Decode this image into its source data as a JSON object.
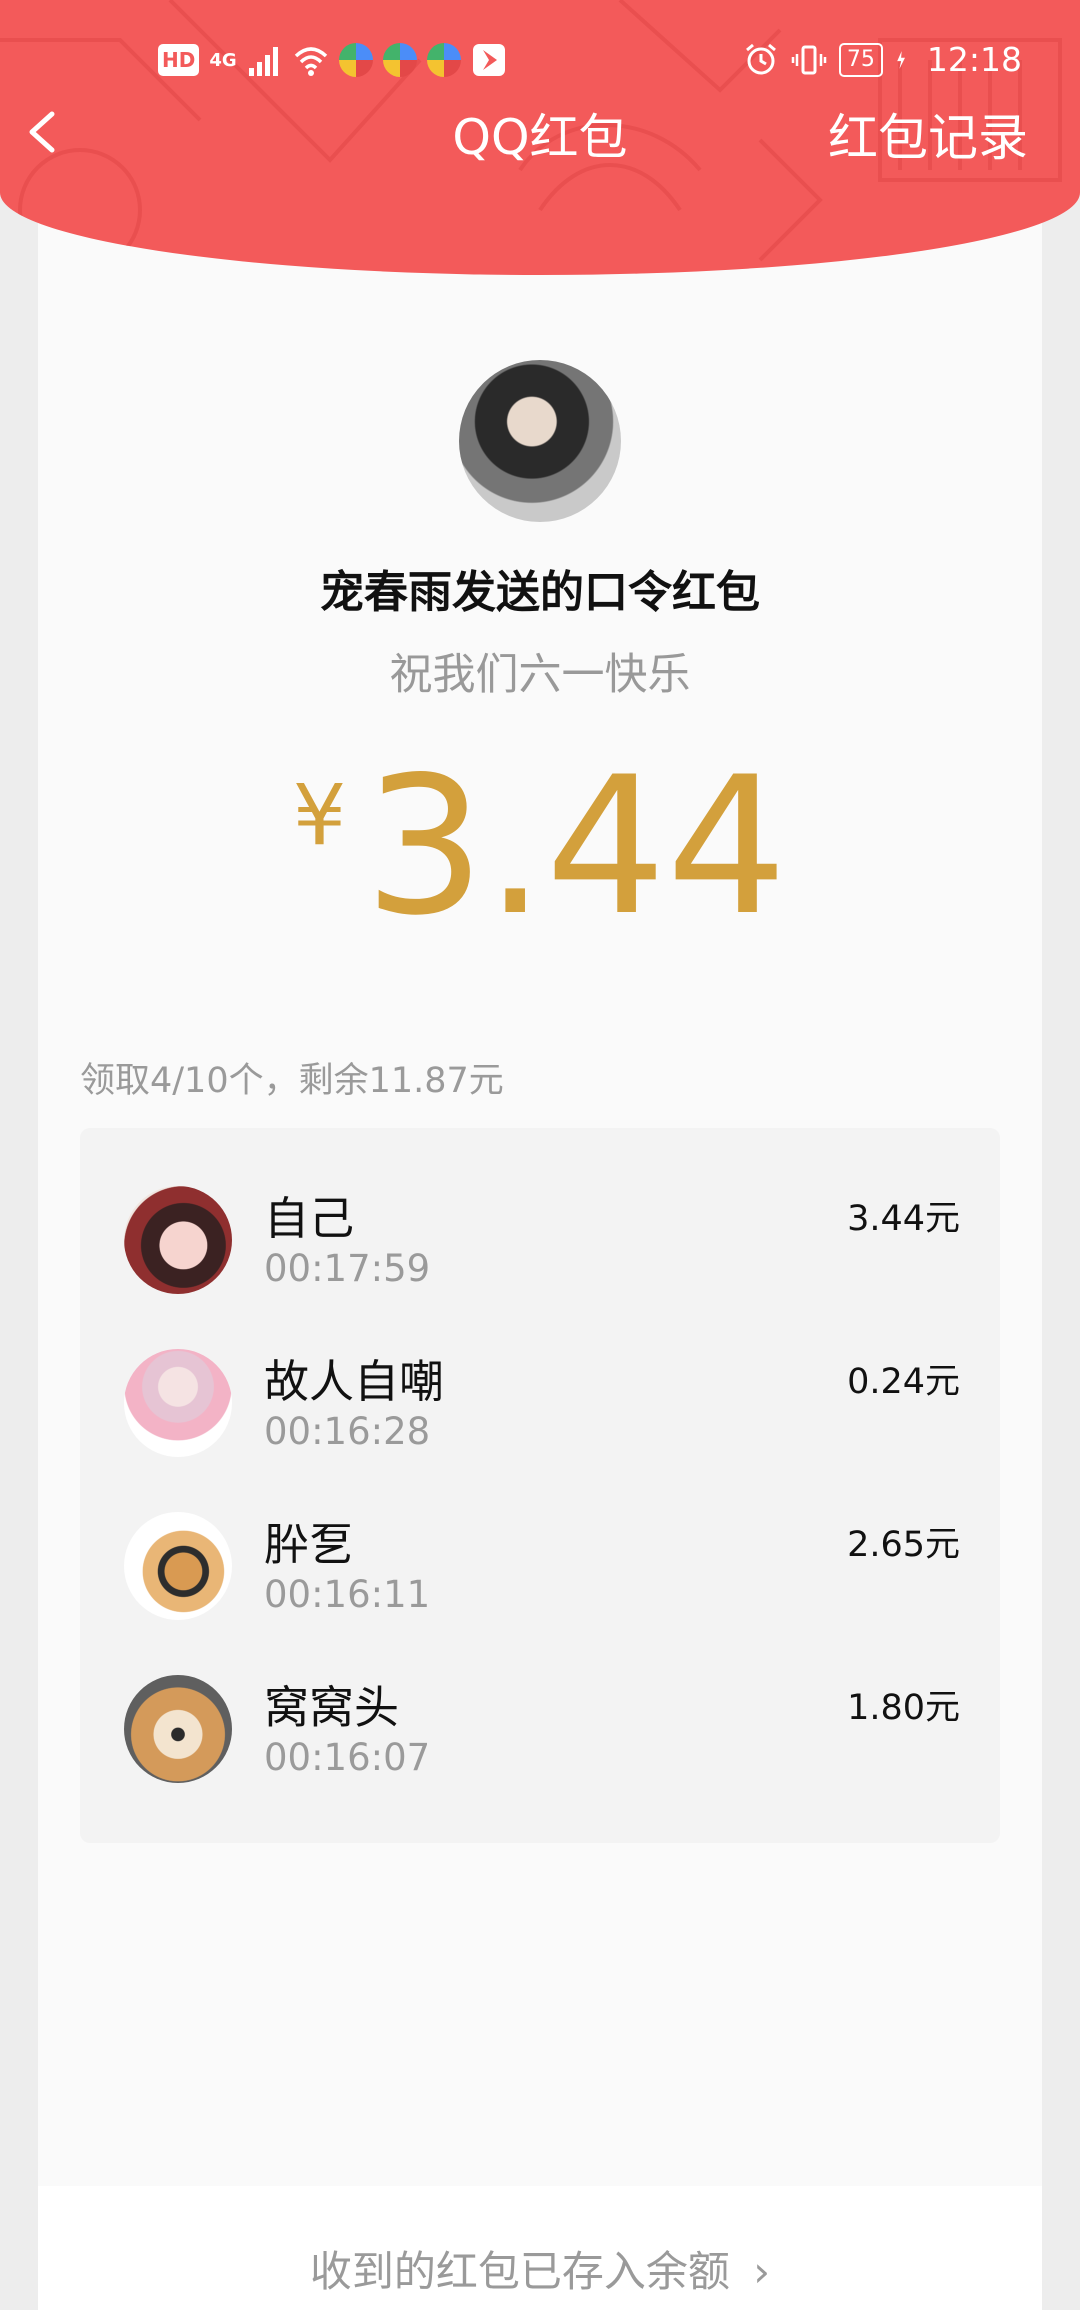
{
  "status_bar": {
    "hd_label": "HD",
    "network_label": "4G",
    "battery_level": "75",
    "time": "12:18",
    "icons": [
      "hd-icon",
      "signal-icon",
      "wifi-icon",
      "app-icon",
      "app-icon",
      "app-icon",
      "notification-icon",
      "alarm-icon",
      "vibrate-icon",
      "battery-icon",
      "charging-icon"
    ]
  },
  "nav": {
    "title": "QQ红包",
    "action": "红包记录",
    "back_icon": "chevron-left-icon"
  },
  "packet": {
    "sender_line": "宠春雨发送的口令红包",
    "greeting": "祝我们六一快乐",
    "currency_symbol": "¥",
    "amount": "3.44"
  },
  "summary": "领取4/10个，剩余11.87元",
  "claims": [
    {
      "name": "自己",
      "time": "00:17:59",
      "amount": "3.44元"
    },
    {
      "name": "故人自嘲",
      "time": "00:16:28",
      "amount": "0.24元"
    },
    {
      "name": "肸乭",
      "time": "00:16:11",
      "amount": "2.65元"
    },
    {
      "name": "窝窝头",
      "time": "00:16:07",
      "amount": "1.80元"
    }
  ],
  "footer": {
    "text": "收到的红包已存入余额",
    "chevron": "›"
  },
  "colors": {
    "header_red": "#f35a5a",
    "amount_gold": "#d3a03c",
    "muted_text": "#9a9a9a"
  }
}
